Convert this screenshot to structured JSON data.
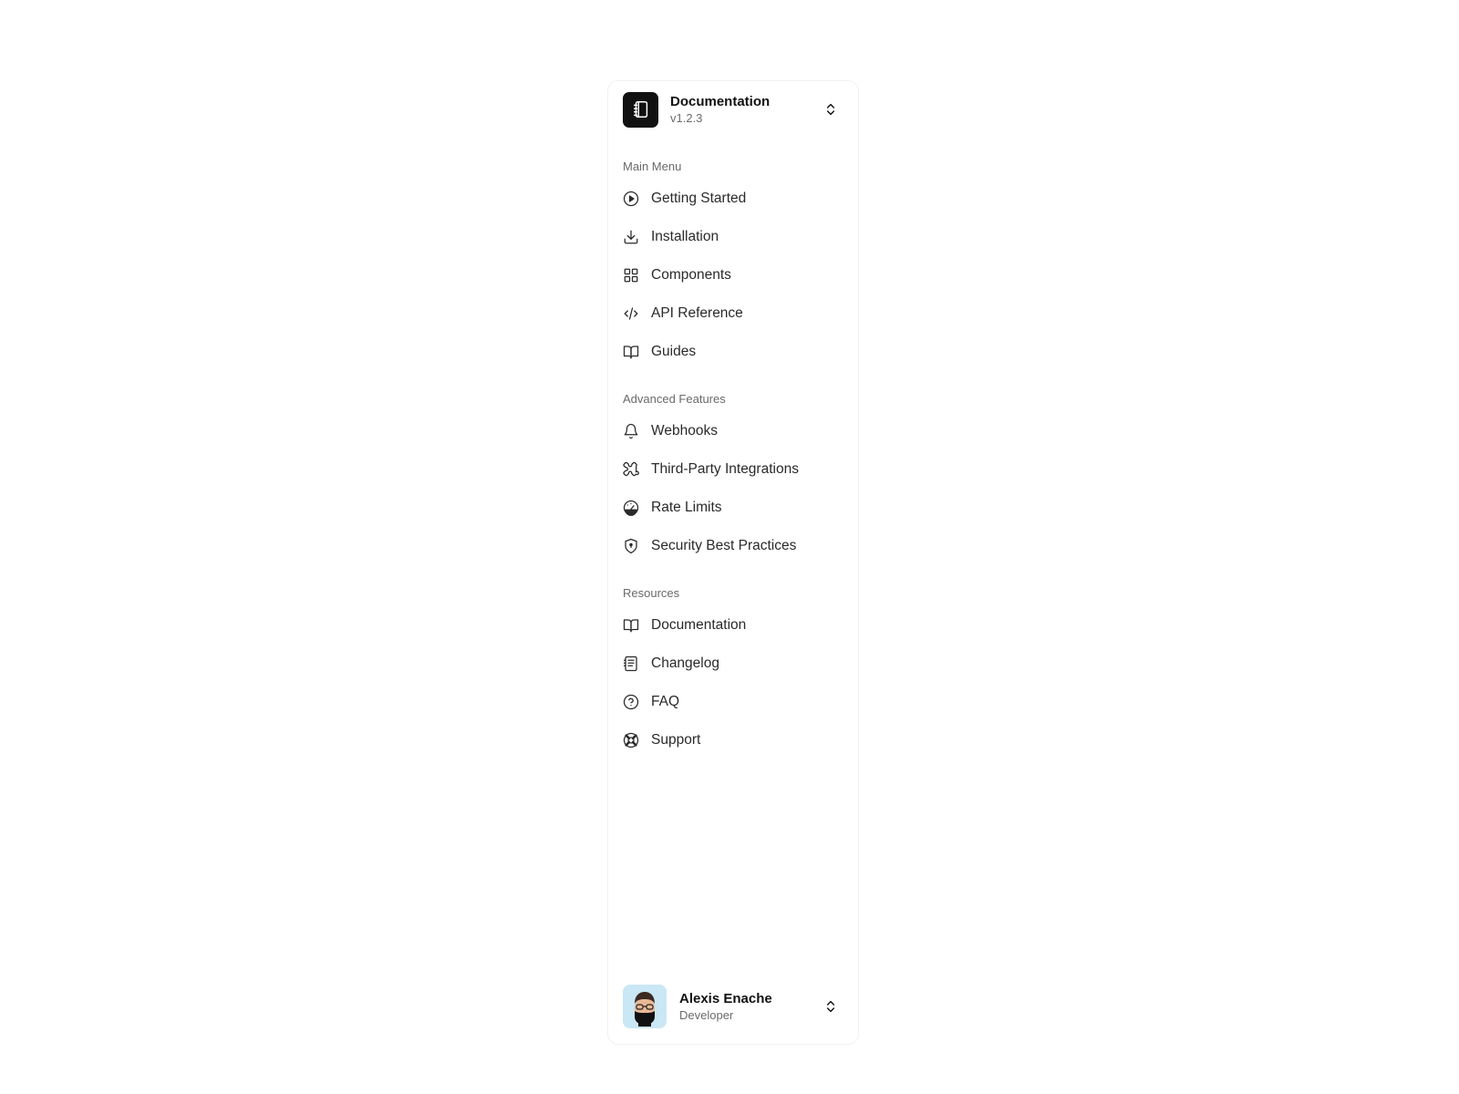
{
  "team": {
    "name": "Documentation",
    "version": "v1.2.3",
    "icon": "notebook-icon"
  },
  "groups": [
    {
      "label": "Main Menu",
      "items": [
        {
          "label": "Getting Started",
          "icon": "play-circle-icon"
        },
        {
          "label": "Installation",
          "icon": "download-icon"
        },
        {
          "label": "Components",
          "icon": "grid-icon"
        },
        {
          "label": "API Reference",
          "icon": "code-icon"
        },
        {
          "label": "Guides",
          "icon": "book-open-icon"
        }
      ]
    },
    {
      "label": "Advanced Features",
      "items": [
        {
          "label": "Webhooks",
          "icon": "bell-icon"
        },
        {
          "label": "Third-Party Integrations",
          "icon": "puzzle-icon"
        },
        {
          "label": "Rate Limits",
          "icon": "gauge-icon"
        },
        {
          "label": "Security Best Practices",
          "icon": "shield-icon"
        }
      ]
    },
    {
      "label": "Resources",
      "items": [
        {
          "label": "Documentation",
          "icon": "book-open-icon"
        },
        {
          "label": "Changelog",
          "icon": "file-text-icon"
        },
        {
          "label": "FAQ",
          "icon": "help-circle-icon"
        },
        {
          "label": "Support",
          "icon": "life-buoy-icon"
        }
      ]
    }
  ],
  "user": {
    "name": "Alexis Enache",
    "role": "Developer",
    "avatar_icon": "user-avatar"
  }
}
